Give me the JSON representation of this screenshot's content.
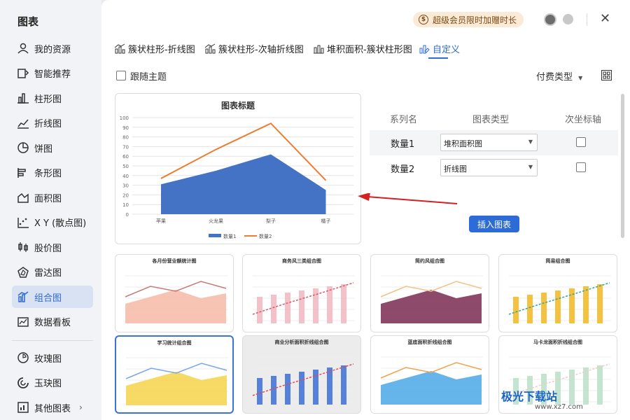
{
  "sidebar": {
    "title": "图表",
    "items": [
      {
        "label": "我的资源",
        "icon": "user-icon"
      },
      {
        "label": "智能推荐",
        "icon": "smart-recommend-icon"
      },
      {
        "label": "柱形图",
        "icon": "column-chart-icon"
      },
      {
        "label": "折线图",
        "icon": "line-chart-icon"
      },
      {
        "label": "饼图",
        "icon": "pie-chart-icon"
      },
      {
        "label": "条形图",
        "icon": "bar-chart-icon"
      },
      {
        "label": "面积图",
        "icon": "area-chart-icon"
      },
      {
        "label": "X Y (散点图)",
        "icon": "scatter-chart-icon"
      },
      {
        "label": "股价图",
        "icon": "stock-chart-icon"
      },
      {
        "label": "雷达图",
        "icon": "radar-chart-icon"
      },
      {
        "label": "组合图",
        "icon": "combo-chart-icon"
      },
      {
        "label": "数据看板",
        "icon": "dashboard-icon"
      }
    ],
    "items2": [
      {
        "label": "玫瑰图",
        "icon": "rose-chart-icon"
      },
      {
        "label": "玉玦图",
        "icon": "jade-ring-chart-icon"
      },
      {
        "label": "其他图表",
        "icon": "other-chart-icon"
      }
    ],
    "active_index": 10
  },
  "header": {
    "vip_text": "超级会员限时加赠时长",
    "close_symbol": "✕"
  },
  "tabs": [
    "簇状柱形-折线图",
    "簇状柱形-次轴折线图",
    "堆积面积-簇状柱形图",
    "自定义"
  ],
  "toolbar": {
    "follow_theme_label": "跟随主题",
    "pay_type_label": "付费类型",
    "pay_type_arrow": "▼"
  },
  "preview_chart": {
    "title": "图表标题",
    "legend": [
      "数量1",
      "数量2"
    ],
    "colors": {
      "series1": "#4472c4",
      "series2": "#ed7d31"
    }
  },
  "settings": {
    "headers": {
      "series": "系列名",
      "type": "图表类型",
      "secondary": "次坐标轴"
    },
    "rows": [
      {
        "name": "数量1",
        "type": "堆积面积图",
        "secondary": false
      },
      {
        "name": "数量2",
        "type": "折线图",
        "secondary": false
      }
    ],
    "insert_label": "插入图表"
  },
  "templates": [
    {
      "title": "各月份营业额统计图"
    },
    {
      "title": "商务风三类组合图"
    },
    {
      "title": "简约风组合图"
    },
    {
      "title": "简易组合图"
    },
    {
      "title": "学习统计组合图"
    },
    {
      "title": "商业分析面积折线组合图"
    },
    {
      "title": "蓝底面积折线组合图"
    },
    {
      "title": "马卡龙面积折线组合图"
    }
  ],
  "watermark": {
    "text": "极光下载站",
    "url_text": "www.xz7.com"
  },
  "chart_data": {
    "type": "area",
    "title": "图表标题",
    "categories": [
      "苹果",
      "火龙果",
      "梨子",
      "橘子"
    ],
    "series": [
      {
        "name": "数量1",
        "type": "area",
        "values": [
          31,
          45,
          62,
          25
        ]
      },
      {
        "name": "数量2",
        "type": "line",
        "values": [
          37,
          67,
          94,
          35
        ]
      }
    ],
    "ylim": [
      0,
      100
    ],
    "yticks": [
      0,
      10,
      20,
      30,
      40,
      50,
      60,
      70,
      80,
      90,
      100
    ],
    "legend_position": "bottom",
    "grid": true
  }
}
